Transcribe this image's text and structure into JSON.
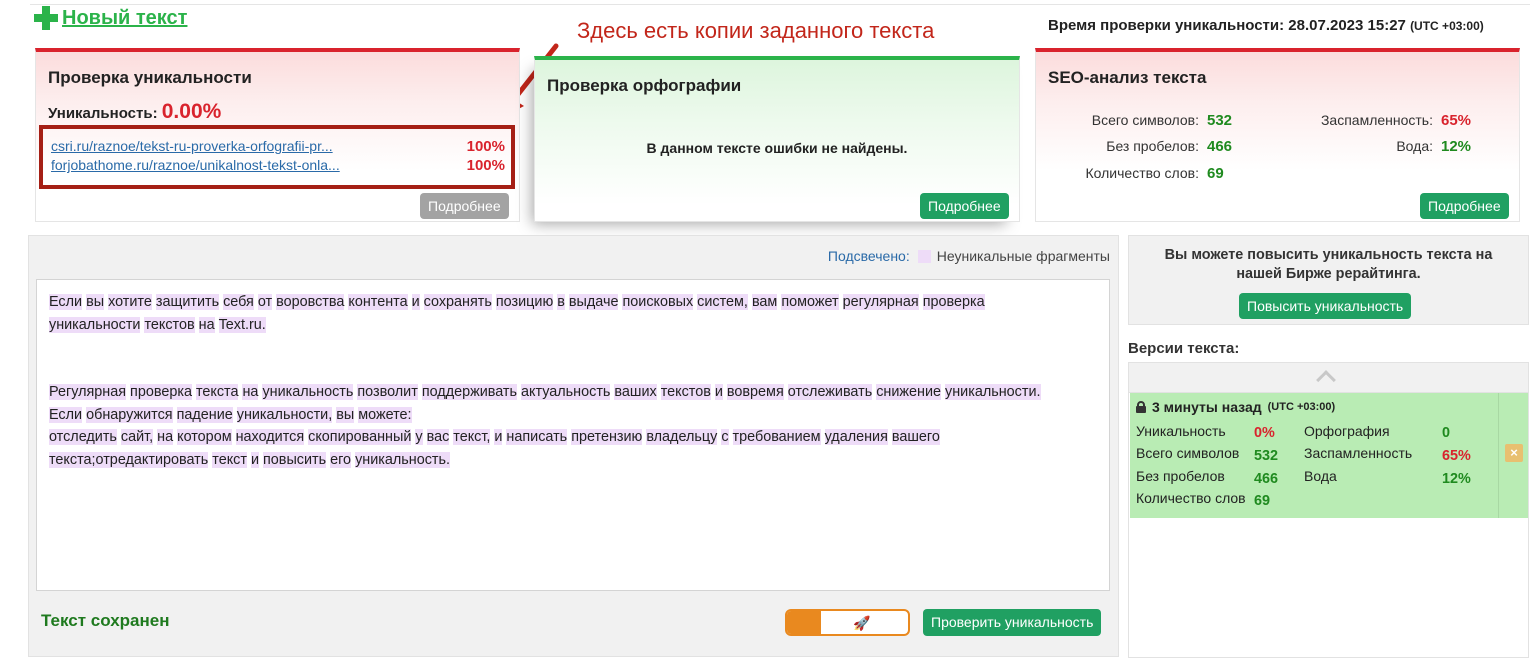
{
  "header": {
    "new_text_label": "Новый текст",
    "annotation": "Здесь есть копии заданного текста",
    "check_time_label": "Время проверки уникальности: 28.07.2023 15:27",
    "check_time_tz": "(UTC +03:00)"
  },
  "uniqueness_card": {
    "title": "Проверка уникальности",
    "uniqueness_label": "Уникальность:",
    "uniqueness_value": "0.00%",
    "sources": [
      {
        "url": "csri.ru/raznoe/tekst-ru-proverka-orfografii-pr...",
        "percent": "100%"
      },
      {
        "url": "forjobathome.ru/raznoe/unikalnost-tekst-onla...",
        "percent": "100%"
      }
    ],
    "details_button": "Подробнее"
  },
  "spelling_card": {
    "title": "Проверка орфографии",
    "message": "В данном тексте ошибки не найдены.",
    "details_button": "Подробнее"
  },
  "seo_card": {
    "title": "SEO-анализ текста",
    "total_chars_label": "Всего символов:",
    "total_chars_value": "532",
    "no_spaces_label": "Без пробелов:",
    "no_spaces_value": "466",
    "word_count_label": "Количество слов:",
    "word_count_value": "69",
    "spam_label": "Заспамленность:",
    "spam_value": "65%",
    "water_label": "Вода:",
    "water_value": "12%",
    "details_button": "Подробнее"
  },
  "editor": {
    "legend_label": "Подсвечено:",
    "legend_text": "Неуникальные фрагменты",
    "paragraphs": [
      [
        "Если",
        "вы",
        "хотите",
        "защитить",
        "себя",
        "от",
        "воровства",
        "контента",
        "и",
        "сохранять",
        "позицию",
        "в",
        "выдаче",
        "поисковых",
        "систем,",
        "вам",
        "поможет",
        "регулярная",
        "проверка"
      ],
      [
        "уникальности",
        "текстов",
        "на",
        "Text.",
        "ru."
      ],
      [
        "Регулярная",
        "проверка",
        "текста",
        "на",
        "уникальность",
        "позволит",
        "поддерживать",
        "актуальность",
        "ваших",
        "текстов",
        "и",
        "вовремя",
        "отслеживать",
        "снижение",
        "уникальности."
      ],
      [
        "Если",
        "обнаружится",
        "падение",
        "уникальности,",
        "вы",
        "можете:"
      ],
      [
        "отследить",
        "сайт,",
        "на",
        "котором",
        "находится",
        "скопированный",
        "у",
        "вас",
        "текст,",
        "и",
        "написать",
        "претензию",
        "владельцу",
        "с",
        "требованием",
        "удаления",
        "вашего"
      ],
      [
        "текста;",
        "отредактировать",
        "текст",
        "и",
        "повысить",
        "его",
        "уникальность."
      ]
    ],
    "saved_status": "Текст сохранен",
    "check_button": "Проверить уникальность"
  },
  "promo": {
    "text_line1": "Вы можете повысить уникальность текста на",
    "text_line2": "нашей Бирже рерайтинга.",
    "button": "Повысить уникальность"
  },
  "versions": {
    "title": "Версии текста:",
    "items": [
      {
        "time": "3 минуты назад",
        "tz": "(UTC +03:00)",
        "uniq_label": "Уникальность",
        "uniq_value": "0%",
        "total_label": "Всего символов",
        "total_value": "532",
        "nospace_label": "Без пробелов",
        "nospace_value": "466",
        "words_label": "Количество слов",
        "words_value": "69",
        "spell_label": "Орфография",
        "spell_value": "0",
        "spam_label": "Заспамленность",
        "spam_value": "65%",
        "water_label": "Вода",
        "water_value": "12%",
        "close_label": "×"
      }
    ]
  }
}
